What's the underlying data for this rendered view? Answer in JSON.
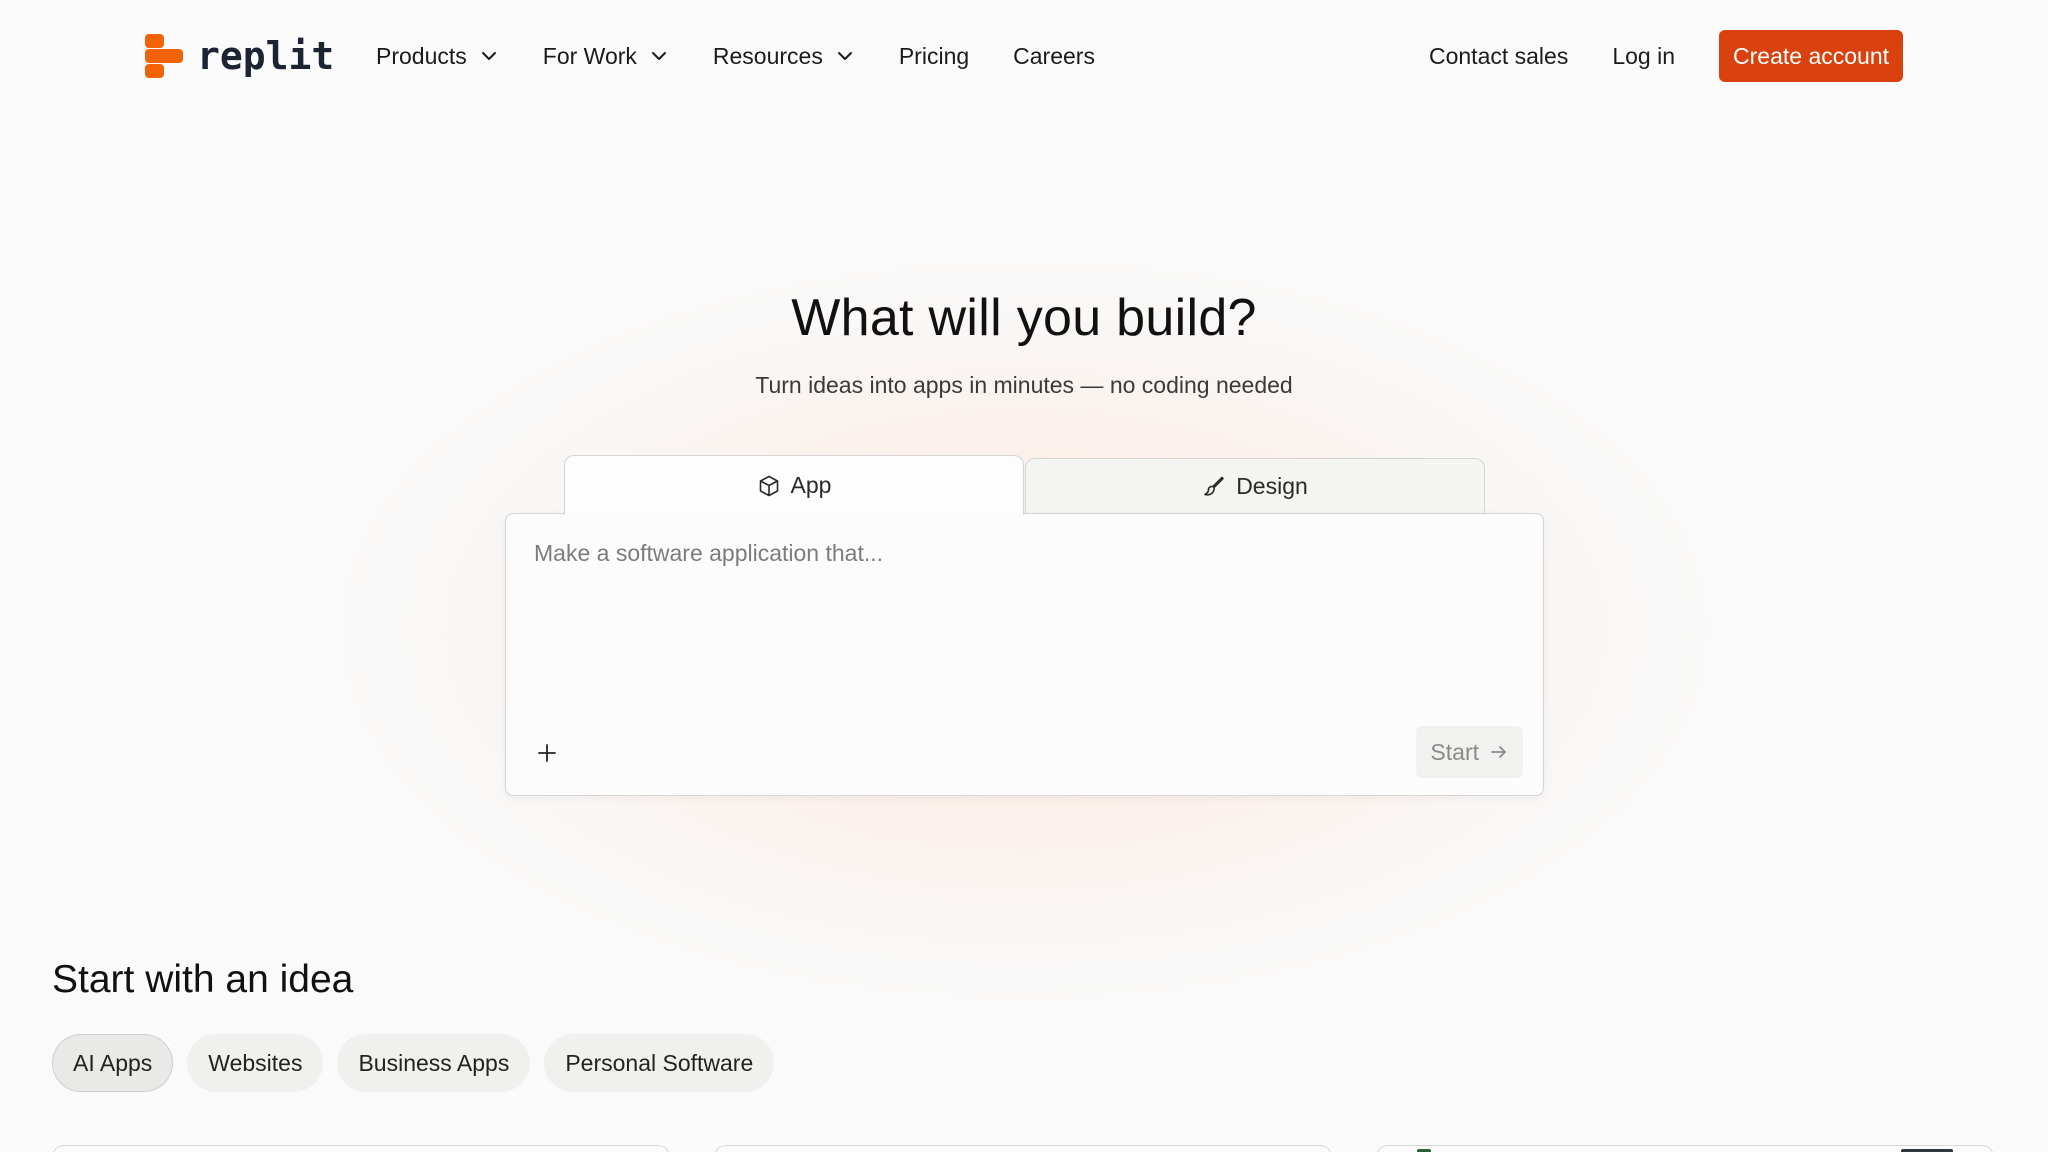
{
  "brand": {
    "name": "replit",
    "accent": "#d9420f",
    "logo_color": "#f26207"
  },
  "nav": {
    "items": [
      {
        "label": "Products",
        "has_menu": true
      },
      {
        "label": "For Work",
        "has_menu": true
      },
      {
        "label": "Resources",
        "has_menu": true
      },
      {
        "label": "Pricing",
        "has_menu": false
      },
      {
        "label": "Careers",
        "has_menu": false
      }
    ],
    "contact_sales": "Contact sales",
    "log_in": "Log in",
    "create_account": "Create account"
  },
  "hero": {
    "title": "What will you build?",
    "subtitle": "Turn ideas into apps in minutes — no coding needed"
  },
  "tabs": [
    {
      "label": "App",
      "icon": "cube-icon",
      "active": true
    },
    {
      "label": "Design",
      "icon": "brush-icon",
      "active": false
    }
  ],
  "prompt": {
    "placeholder": "Make a software application that...",
    "value": "",
    "start_label": "Start"
  },
  "ideas": {
    "title": "Start with an idea",
    "categories": [
      {
        "label": "AI Apps",
        "active": true
      },
      {
        "label": "Websites",
        "active": false
      },
      {
        "label": "Business Apps",
        "active": false
      },
      {
        "label": "Personal Software",
        "active": false
      }
    ]
  }
}
